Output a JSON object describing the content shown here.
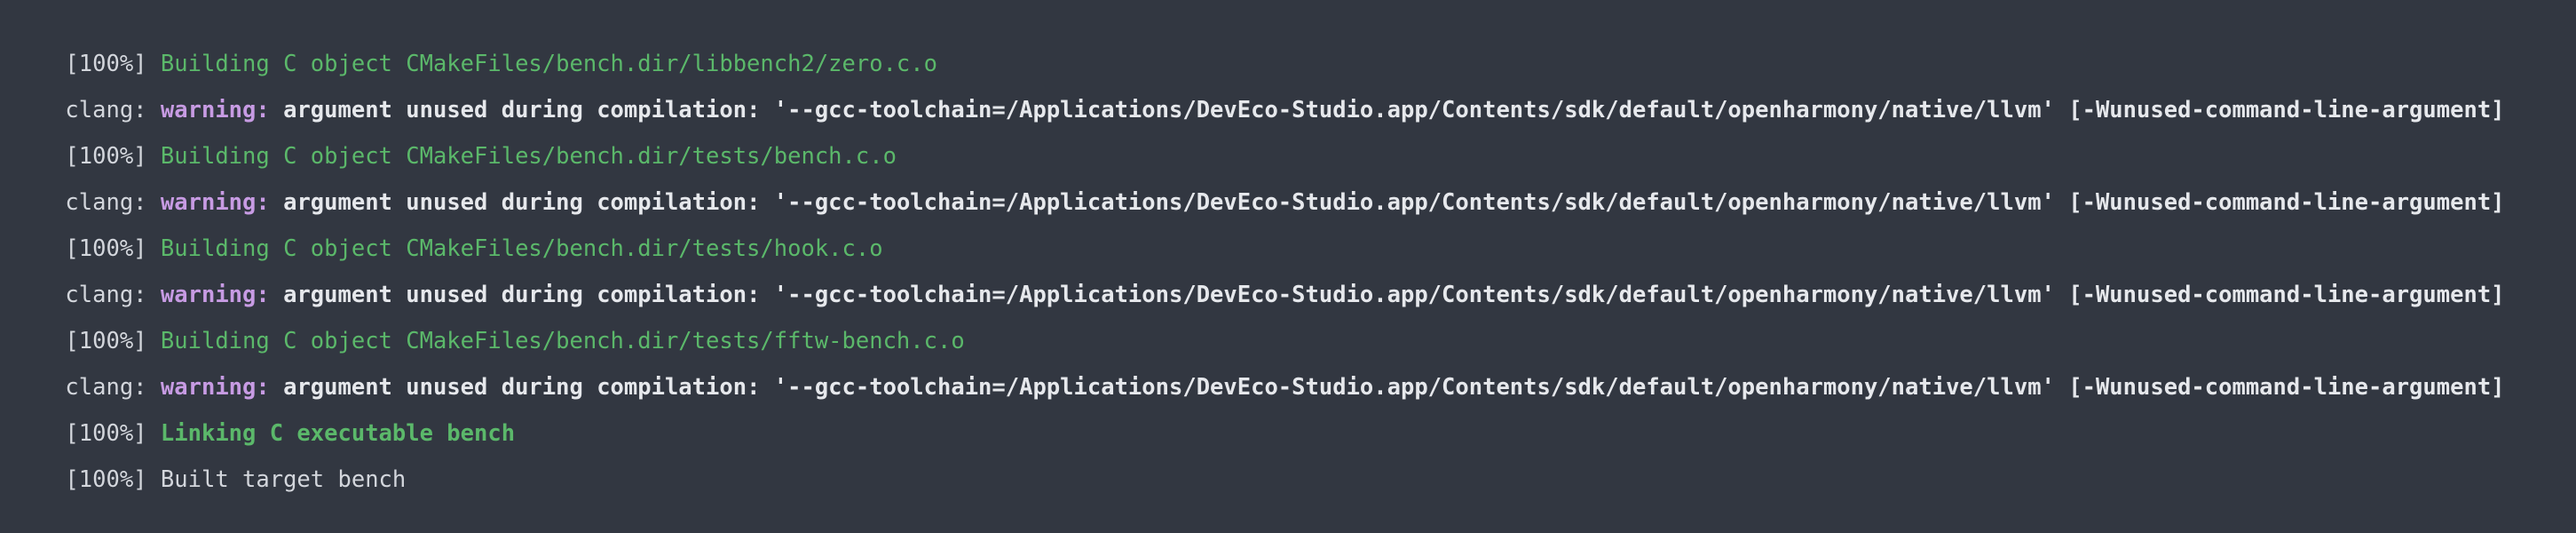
{
  "terminal": {
    "lines": [
      {
        "type": "build",
        "prefix": "[100%]",
        "text": "Building C object CMakeFiles/bench.dir/libbench2/zero.c.o"
      },
      {
        "type": "warning",
        "tool": "clang:",
        "keyword": "warning:",
        "message": "argument unused during compilation: '--gcc-toolchain=/Applications/DevEco-Studio.app/Contents/sdk/default/openharmony/native/llvm' [-Wunused-command-line-argument]"
      },
      {
        "type": "build",
        "prefix": "[100%]",
        "text": "Building C object CMakeFiles/bench.dir/tests/bench.c.o"
      },
      {
        "type": "warning",
        "tool": "clang:",
        "keyword": "warning:",
        "message": "argument unused during compilation: '--gcc-toolchain=/Applications/DevEco-Studio.app/Contents/sdk/default/openharmony/native/llvm' [-Wunused-command-line-argument]"
      },
      {
        "type": "build",
        "prefix": "[100%]",
        "text": "Building C object CMakeFiles/bench.dir/tests/hook.c.o"
      },
      {
        "type": "warning",
        "tool": "clang:",
        "keyword": "warning:",
        "message": "argument unused during compilation: '--gcc-toolchain=/Applications/DevEco-Studio.app/Contents/sdk/default/openharmony/native/llvm' [-Wunused-command-line-argument]"
      },
      {
        "type": "build",
        "prefix": "[100%]",
        "text": "Building C object CMakeFiles/bench.dir/tests/fftw-bench.c.o"
      },
      {
        "type": "warning",
        "tool": "clang:",
        "keyword": "warning:",
        "message": "argument unused during compilation: '--gcc-toolchain=/Applications/DevEco-Studio.app/Contents/sdk/default/openharmony/native/llvm' [-Wunused-command-line-argument]"
      },
      {
        "type": "link",
        "prefix": "[100%]",
        "text": "Linking C executable bench"
      },
      {
        "type": "done",
        "prefix": "[100%]",
        "text": "Built target bench"
      }
    ]
  },
  "colors": {
    "background": "#323741",
    "build_green": "#5bb86a",
    "warning_purple": "#c79be3",
    "text": "#d3d6dc"
  }
}
